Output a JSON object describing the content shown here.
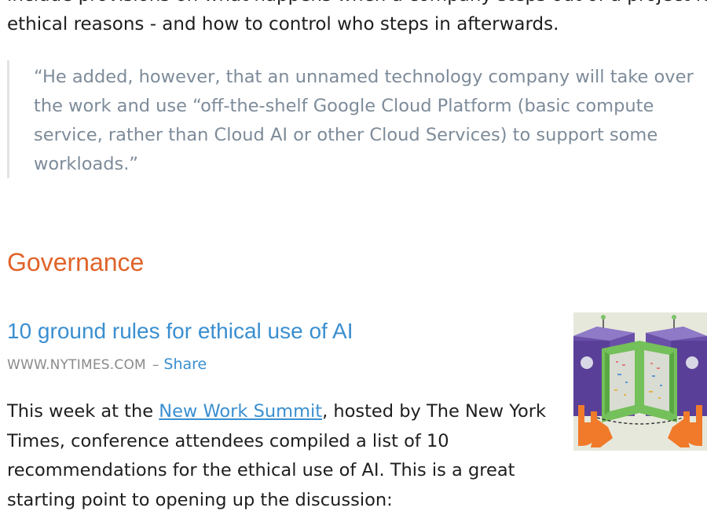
{
  "intro": {
    "line1": "include provisions on what happens when a company steps out of a project for",
    "line2": "ethical reasons - and how to control who steps in afterwards."
  },
  "quote": {
    "line1": "“He added, however, that an unnamed technology company will take over",
    "line2": "the work and use “off-the-shelf Google Cloud Platform (basic compute",
    "line3": "service, rather than Cloud AI or other Cloud Services) to support some",
    "line4": "workloads.”"
  },
  "section": {
    "heading": "Governance"
  },
  "article": {
    "title": "10 ground rules for ethical use of AI",
    "source": "WWW.NYTIMES.COM",
    "separator": "–",
    "share_label": "Share",
    "body": {
      "line1_prefix": "This week at the ",
      "line1_link": "New Work Summit",
      "line1_suffix": ", hosted by The New York",
      "line2": "Times, conference attendees compiled a list of 10",
      "line3": "recommendations for the ethical use of AI. This is a great",
      "line4": "starting point to opening up the discussion:"
    }
  },
  "colors": {
    "section_heading": "#e0632a",
    "link": "#3a8fd0",
    "quote_text": "#7d8b99",
    "body_text": "#1e1e1e"
  }
}
